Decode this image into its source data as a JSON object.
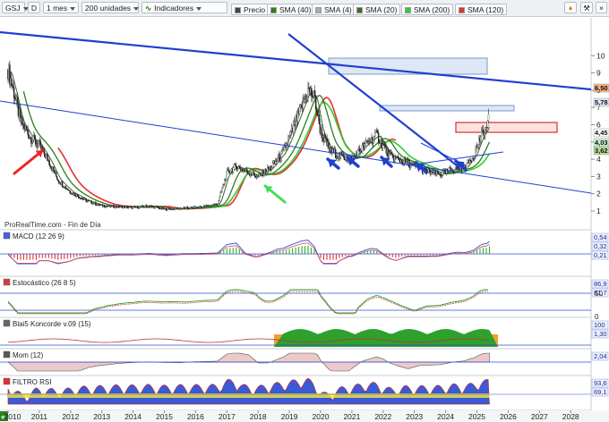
{
  "toolbar": {
    "symbol": "GSJ",
    "symbol_menu": "D",
    "period": "1 mes",
    "units": "200 unidades",
    "indicators": "Indicadores",
    "legend": [
      {
        "label": "Precio",
        "color": "#444444"
      },
      {
        "label": "SMA (40)",
        "color": "#2e7d1e"
      },
      {
        "label": "SMA (4)",
        "color": "#aaaaaa"
      },
      {
        "label": "SMA (20)",
        "color": "#3a6b2a"
      },
      {
        "label": "SMA (200)",
        "color": "#33cc33"
      },
      {
        "label": "SMA (120)",
        "color": "#e53030"
      }
    ]
  },
  "source_label": "ProRealTime.com - Fin de Día",
  "x_axis": {
    "years": [
      "2010",
      "2011",
      "2012",
      "2013",
      "2014",
      "2015",
      "2016",
      "2017",
      "2018",
      "2019",
      "2020",
      "2021",
      "2022",
      "2023",
      "2024",
      "2025",
      "2026",
      "2027",
      "2028"
    ],
    "nav": "«"
  },
  "price_axis": {
    "ticks": [
      "10",
      "9",
      "8",
      "7",
      "6",
      "5",
      "4",
      "3",
      "2",
      "1"
    ],
    "badges": [
      {
        "label": "6,50",
        "color": "#f4b183"
      },
      {
        "label": "5,78",
        "color": "#dde7f5"
      },
      {
        "label": "4,45",
        "color": "#ffffff"
      },
      {
        "label": "4,03",
        "color": "#c6efce"
      },
      {
        "label": "3,62",
        "color": "#b7dd9b"
      }
    ]
  },
  "panels": [
    {
      "label": "MACD (12 26 9)",
      "values": [
        "0,54",
        "0,32",
        "0,21"
      ]
    },
    {
      "label": "Estocástico (26 8 5)",
      "values": [
        "86,9",
        "81,7"
      ],
      "ticks": [
        "50",
        "0"
      ]
    },
    {
      "label": "Blai5 Koncorde v.09 (15)",
      "values": [
        "100",
        "1,30"
      ]
    },
    {
      "label": "Mom (12)",
      "values": [
        "2,04"
      ]
    },
    {
      "label": "FILTRO RSI",
      "values": [
        "93,6",
        "69,1"
      ]
    }
  ],
  "colors": {
    "trend_blue": "#1f3fd0",
    "arrow_red": "#ee2222",
    "arrow_green": "#44dd55",
    "arrow_blue": "#1f3fd0"
  },
  "chart_data": {
    "type": "line",
    "title": "GSJ",
    "ylim": [
      0.5,
      10
    ],
    "x": [
      2010.0,
      2010.2,
      2010.4,
      2010.7,
      2011.0,
      2011.3,
      2011.6,
      2012.0,
      2012.5,
      2013.0,
      2013.5,
      2014.0,
      2014.5,
      2015.0,
      2015.5,
      2016.0,
      2016.4,
      2016.7,
      2017.0,
      2017.3,
      2017.6,
      2018.0,
      2018.4,
      2018.8,
      2019.0,
      2019.3,
      2019.6,
      2019.8,
      2020.0,
      2020.3,
      2020.6,
      2021.0,
      2021.4,
      2021.8,
      2022.2,
      2022.6,
      2023.0,
      2023.4,
      2023.8,
      2024.2,
      2024.6,
      2024.9,
      2025.1,
      2025.3,
      2025.4
    ],
    "series": [
      {
        "name": "Precio",
        "values": [
          9.2,
          7.8,
          6.2,
          5.3,
          4.8,
          3.9,
          2.8,
          2.1,
          1.6,
          1.3,
          1.25,
          1.2,
          1.3,
          1.1,
          1.15,
          1.2,
          1.3,
          1.4,
          3.2,
          3.6,
          3.3,
          3.0,
          3.5,
          4.4,
          5.2,
          6.6,
          8.0,
          7.6,
          5.6,
          4.5,
          4.2,
          4.0,
          4.8,
          5.4,
          4.2,
          3.9,
          3.6,
          3.3,
          3.1,
          3.4,
          3.5,
          4.2,
          5.2,
          5.8,
          6.5
        ]
      }
    ]
  }
}
